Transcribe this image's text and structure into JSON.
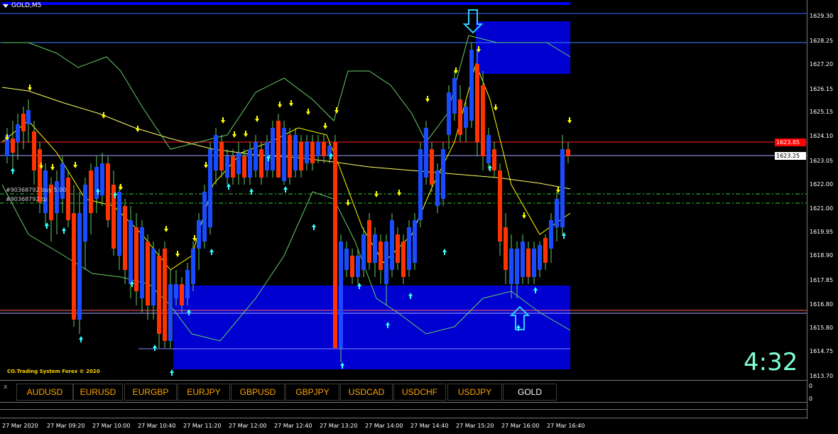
{
  "window": {
    "title": "GOLD,M5"
  },
  "price_axis": {
    "labels": [
      "1629.30",
      "1628.25",
      "1627.20",
      "1626.15",
      "1625.15",
      "1624.10",
      "1623.05",
      "1622.00",
      "1621.00",
      "1619.95",
      "1618.90",
      "1617.85",
      "1616.80",
      "1615.80",
      "1614.75",
      "1613.70"
    ]
  },
  "price_tags": [
    {
      "value": "1623.85",
      "bg": "#ff0000",
      "fg": "#ffffff"
    },
    {
      "value": "1623.25",
      "bg": "#ffffff",
      "fg": "#000000"
    }
  ],
  "time_axis": {
    "labels": [
      "27 Mar 2020",
      "27 Mar 09:20",
      "27 Mar 10:00",
      "27 Mar 10:40",
      "27 Mar 11:20",
      "27 Mar 12:00",
      "27 Mar 12:40",
      "27 Mar 13:20",
      "27 Mar 14:00",
      "27 Mar 14:40",
      "27 Mar 15:20",
      "27 Mar 16:00",
      "27 Mar 16:40"
    ]
  },
  "orders": [
    "#90368792 buy 5.00",
    "#90368792 tp"
  ],
  "watermark": "CO.Trading System Forex © 2020",
  "countdown": "4:32",
  "symbol_bar": {
    "close": "x",
    "buttons": [
      "AUDUSD",
      "EURUSD",
      "EURGBP",
      "EURJPY",
      "GBPUSD",
      "GBPJPY",
      "USDCAD",
      "USDCHF",
      "USDJPY",
      "GOLD"
    ],
    "active": "GOLD",
    "right_zero_top": "0",
    "right_zero_bottom": "0"
  },
  "colors": {
    "bull": "#1a4cff",
    "bear": "#ff3300",
    "zone": "#0000d0",
    "ma": "#ffff66",
    "band": "#66cc66",
    "arrow_up": "#33ffff",
    "arrow_down": "#ffff00"
  }
}
